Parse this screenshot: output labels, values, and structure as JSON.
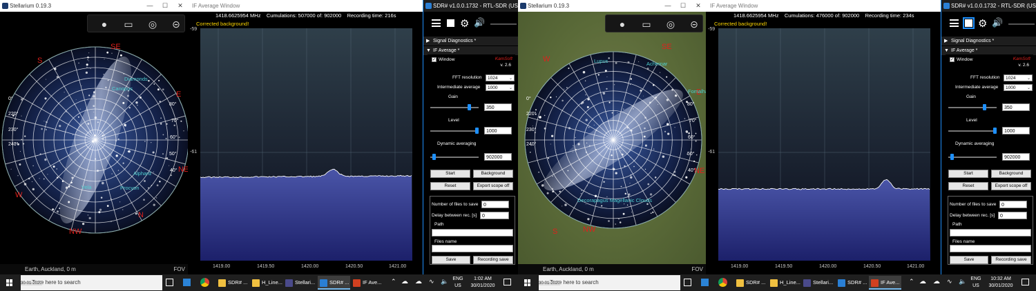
{
  "colors": {
    "accent": "#1e90ff",
    "header_yellow": "#ffd800",
    "spectrum_fill": "#3a3f9a",
    "taskbar": "#1f1f1f"
  },
  "halves": [
    {
      "stellarium": {
        "title": "Stellarium 0.19.3",
        "status": "Earth, Auckland, 0 m",
        "fov": "FOV",
        "cardinals": {
          "s": "S",
          "se": "SE",
          "e": "E",
          "ne": "NE",
          "n": "N",
          "nw": "NW",
          "w": "W",
          "sw": "SW"
        },
        "grid_labels": [
          "0°",
          "220°",
          "230°",
          "240°",
          "80°",
          "70°",
          "60°",
          "50°",
          "40°"
        ],
        "stars": [
          "Diamonds",
          "Canopus",
          "Alphard",
          "Vela",
          "Procyon"
        ]
      },
      "ifwin": {
        "title": "IF Average Window",
        "freq": "1418.6625954 MHz",
        "cumulations": "Cumulations: 507000 of: 902000",
        "recording": "Recording time: 216s",
        "corrected": "Corrected background!",
        "y_top": "-59",
        "y_mid": "-61",
        "xticks": [
          "1419.00",
          "1419.50",
          "1420.00",
          "1420.50",
          "1421.00"
        ]
      },
      "sdr": {
        "title": "SDR# v1.0.0.1732 - RTL-SDR (USB)",
        "sig_diag": "Signal Diagnostics *",
        "if_avg": "IF Average *",
        "window_label": "Window",
        "brand": "KamSoft",
        "version": "v. 2.6",
        "fft_label": "FFT resolution",
        "fft_value": "1024",
        "inter_label": "Intermediate average",
        "inter_value": "1000",
        "gain_label": "Gain",
        "gain_value": "350",
        "gain_level": 0.82,
        "level_label": "Level",
        "level_value": "1000",
        "level_level": 0.98,
        "dyn_label": "Dynamic averaging",
        "dyn_value": "902000",
        "dyn_level": 0.05,
        "btn_start": "Start",
        "btn_background": "Background",
        "btn_reset": "Reset",
        "btn_export": "Export scope off",
        "files_label": "Number of files to save",
        "files_value": "0",
        "delay_label": "Delay between rec. [s]",
        "delay_value": "0",
        "path_label": "Path",
        "files_name_label": "Files name",
        "btn_save": "Save",
        "btn_save2": "Recording save"
      },
      "taskbar": {
        "search": "Type here to search",
        "items": [
          "SDR# ...",
          "H_Line...",
          "Stellari...",
          "SDR# ...",
          "IF Ave..."
        ],
        "lang1": "ENG",
        "lang2": "US",
        "time": "1:02 AM",
        "date": "30/01/2020",
        "preview": "30-01-2020"
      }
    },
    {
      "stellarium": {
        "title": "Stellarium 0.19.3",
        "status": "Earth, Auckland, 0 m",
        "fov": "FOV",
        "cardinals": {
          "s": "S",
          "se": "SE",
          "e": "E",
          "ne": "NE",
          "n": "N",
          "nw": "NW",
          "w": "W",
          "sw": "SW"
        },
        "grid_labels": [
          "0°",
          "220°",
          "230°",
          "240°",
          "80°",
          "70°",
          "60°",
          "50°",
          "40°"
        ],
        "stars": [
          "Lupus",
          "Achernar",
          "Fomalhaut",
          "Decorapagus Magellanic Clouds"
        ]
      },
      "ifwin": {
        "title": "IF Average Window",
        "freq": "1418.6625954 MHz",
        "cumulations": "Cumulations: 476000 of: 902000",
        "recording": "Recording time: 234s",
        "corrected": "Corrected background!",
        "y_top": "-59",
        "y_mid": "-61",
        "xticks": [
          "1419.00",
          "1419.50",
          "1420.00",
          "1420.50",
          "1421.00"
        ]
      },
      "sdr": {
        "title": "SDR# v1.0.0.1732 - RTL-SDR (USB)",
        "sig_diag": "Signal Diagnostics *",
        "if_avg": "IF Average *",
        "window_label": "Window",
        "brand": "KamSoft",
        "version": "v. 2.6",
        "fft_label": "FFT resolution",
        "fft_value": "1024",
        "inter_label": "Intermediate average",
        "inter_value": "1000",
        "gain_label": "Gain",
        "gain_value": "350",
        "gain_level": 0.75,
        "level_label": "Level",
        "level_value": "1000",
        "level_level": 0.98,
        "dyn_label": "Dynamic averaging",
        "dyn_value": "902000",
        "dyn_level": 0.05,
        "btn_start": "Start",
        "btn_background": "Background",
        "btn_reset": "Reset",
        "btn_export": "Export scope off",
        "files_label": "Number of files to save",
        "files_value": "0",
        "delay_label": "Delay between rec. [s]",
        "delay_value": "0",
        "path_label": "Path",
        "files_name_label": "Files name",
        "btn_save": "Save",
        "btn_save2": "Recording save"
      },
      "taskbar": {
        "search": "Type here to search",
        "items": [
          "SDR# ...",
          "H_Line...",
          "Stellari...",
          "SDR# ...",
          "IF Ave..."
        ],
        "lang1": "ENG",
        "lang2": "US",
        "time": "10:32 AM",
        "date": "30/01/2020",
        "preview": "30-01-2020"
      }
    }
  ]
}
